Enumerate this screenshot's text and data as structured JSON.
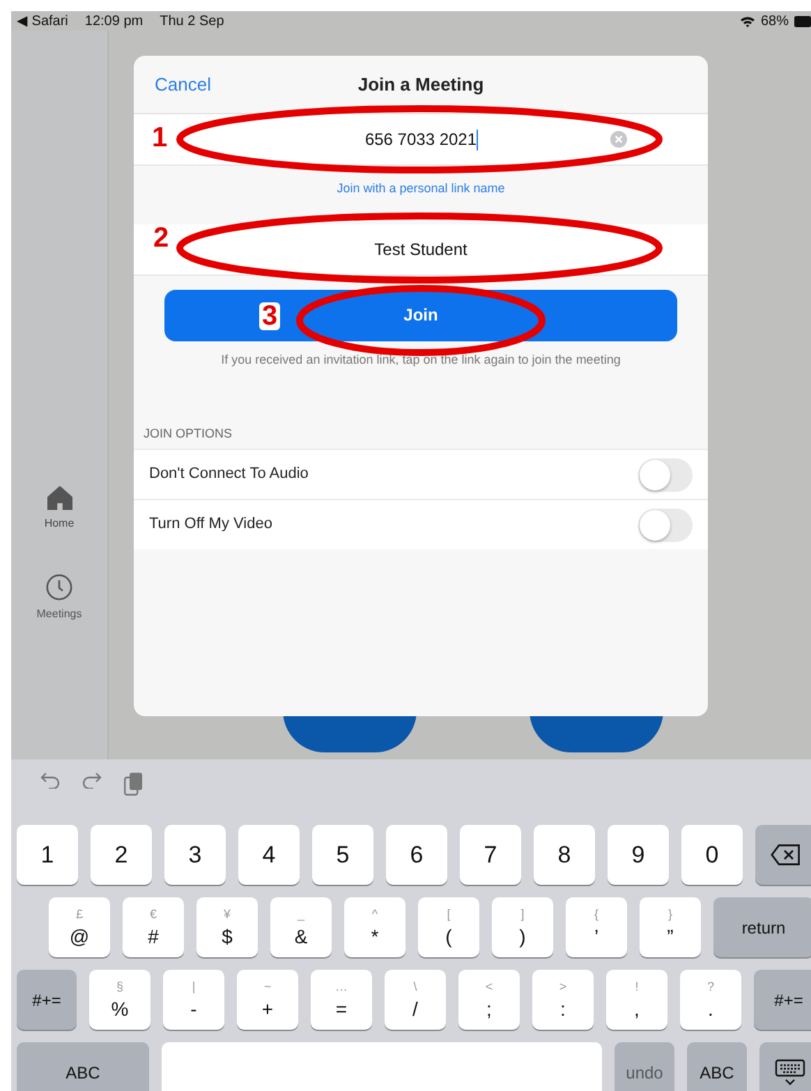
{
  "status_bar": {
    "back_app": "◀ Safari",
    "time": "12:09 pm",
    "date": "Thu 2 Sep",
    "battery": "68%"
  },
  "sidebar": {
    "items": [
      {
        "label": "Home",
        "selected": true
      },
      {
        "label": "Meetings",
        "selected": false
      }
    ]
  },
  "dialog": {
    "cancel": "Cancel",
    "title": "Join a Meeting",
    "meeting_id": {
      "value": "656 7033 2021"
    },
    "personal_link": "Join with a personal link name",
    "name_field": {
      "value": "Test Student"
    },
    "join_button": "Join",
    "hint": "If you received an invitation link, tap on the link again to join the meeting",
    "options_header": "JOIN OPTIONS",
    "options": [
      {
        "label": "Don't Connect To Audio",
        "on": false
      },
      {
        "label": "Turn Off My Video",
        "on": false
      }
    ]
  },
  "annotations": [
    {
      "number": "1"
    },
    {
      "number": "2"
    },
    {
      "number": "3"
    }
  ],
  "keyboard": {
    "rows": [
      {
        "keys": [
          {
            "kind": "char",
            "main": "1"
          },
          {
            "kind": "char",
            "main": "2"
          },
          {
            "kind": "char",
            "main": "3"
          },
          {
            "kind": "char",
            "main": "4"
          },
          {
            "kind": "char",
            "main": "5"
          },
          {
            "kind": "char",
            "main": "6"
          },
          {
            "kind": "char",
            "main": "7"
          },
          {
            "kind": "char",
            "main": "8"
          },
          {
            "kind": "char",
            "main": "9"
          },
          {
            "kind": "char",
            "main": "0"
          },
          {
            "kind": "delete"
          }
        ]
      },
      {
        "keys": [
          {
            "kind": "char",
            "alt": "£",
            "main": "@"
          },
          {
            "kind": "char",
            "alt": "€",
            "main": "#"
          },
          {
            "kind": "char",
            "alt": "¥",
            "main": "$"
          },
          {
            "kind": "char",
            "alt": "_",
            "main": "&"
          },
          {
            "kind": "char",
            "alt": "^",
            "main": "*"
          },
          {
            "kind": "char",
            "alt": "[",
            "main": "("
          },
          {
            "kind": "char",
            "alt": "]",
            "main": ")"
          },
          {
            "kind": "char",
            "alt": "{",
            "main": "’"
          },
          {
            "kind": "char",
            "alt": "}",
            "main": "”"
          },
          {
            "kind": "func",
            "label": "return"
          }
        ]
      },
      {
        "keys": [
          {
            "kind": "func",
            "label": "#+="
          },
          {
            "kind": "char",
            "alt": "§",
            "main": "%"
          },
          {
            "kind": "char",
            "alt": "|",
            "main": "-"
          },
          {
            "kind": "char",
            "alt": "~",
            "main": "+"
          },
          {
            "kind": "char",
            "alt": "…",
            "main": "="
          },
          {
            "kind": "char",
            "alt": "\\",
            "main": "/"
          },
          {
            "kind": "char",
            "alt": "<",
            "main": ";"
          },
          {
            "kind": "char",
            "alt": ">",
            "main": ":"
          },
          {
            "kind": "char",
            "alt": "!",
            "main": ","
          },
          {
            "kind": "char",
            "alt": "?",
            "main": "."
          },
          {
            "kind": "func",
            "label": "#+="
          }
        ]
      },
      {
        "keys": [
          {
            "kind": "func",
            "label": "ABC"
          },
          {
            "kind": "space"
          },
          {
            "kind": "func",
            "label": "undo",
            "disabled": true
          },
          {
            "kind": "func",
            "label": "ABC"
          },
          {
            "kind": "hide"
          }
        ]
      }
    ]
  }
}
